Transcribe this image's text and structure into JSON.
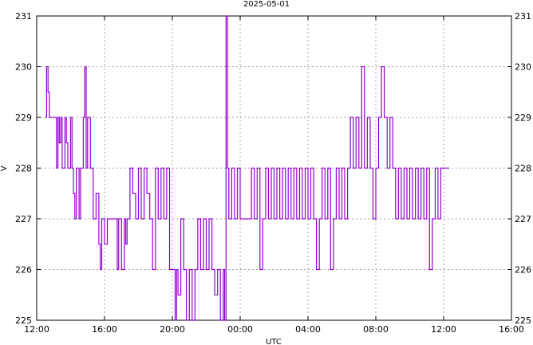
{
  "chart_data": {
    "type": "line",
    "title": "2025-05-01",
    "xlabel": "UTC",
    "ylabel": "V",
    "x_ticks": [
      "12:00",
      "16:00",
      "20:00",
      "00:00",
      "04:00",
      "08:00",
      "12:00",
      "16:00"
    ],
    "y_ticks": [
      "225",
      "226",
      "227",
      "228",
      "229",
      "230",
      "231"
    ],
    "y_ticks_right": [
      "225",
      "226",
      "227",
      "228",
      "229",
      "230",
      "231"
    ],
    "xlim": [
      "2025-05-01 12:00",
      "2025-05-02 16:00"
    ],
    "ylim": [
      225,
      231
    ],
    "grid": true,
    "line_color": "#9400d3",
    "series": [
      {
        "points": [
          [
            "12:30",
            229
          ],
          [
            "12:35",
            230
          ],
          [
            "12:40",
            229.5
          ],
          [
            "12:45",
            229
          ],
          [
            "13:00",
            229
          ],
          [
            "13:10",
            228
          ],
          [
            "13:15",
            229
          ],
          [
            "13:20",
            228.5
          ],
          [
            "13:25",
            229
          ],
          [
            "13:30",
            228
          ],
          [
            "13:40",
            229
          ],
          [
            "13:45",
            228.5
          ],
          [
            "13:50",
            228
          ],
          [
            "14:00",
            229
          ],
          [
            "14:05",
            228
          ],
          [
            "14:10",
            227.5
          ],
          [
            "14:15",
            227
          ],
          [
            "14:20",
            228
          ],
          [
            "14:30",
            227
          ],
          [
            "14:35",
            228
          ],
          [
            "14:45",
            229
          ],
          [
            "14:50",
            230
          ],
          [
            "14:55",
            228
          ],
          [
            "15:00",
            229
          ],
          [
            "15:10",
            228
          ],
          [
            "15:20",
            227
          ],
          [
            "15:30",
            227.5
          ],
          [
            "15:40",
            226.5
          ],
          [
            "15:45",
            226
          ],
          [
            "15:50",
            227
          ],
          [
            "16:00",
            226.5
          ],
          [
            "16:10",
            227
          ],
          [
            "16:30",
            227
          ],
          [
            "16:45",
            226
          ],
          [
            "16:50",
            227
          ],
          [
            "17:00",
            226
          ],
          [
            "17:10",
            227
          ],
          [
            "17:15",
            226.5
          ],
          [
            "17:20",
            227
          ],
          [
            "17:30",
            228
          ],
          [
            "17:40",
            227.5
          ],
          [
            "17:50",
            227
          ],
          [
            "18:00",
            228
          ],
          [
            "18:10",
            227
          ],
          [
            "18:20",
            228
          ],
          [
            "18:30",
            227.5
          ],
          [
            "18:40",
            227
          ],
          [
            "18:50",
            226
          ],
          [
            "19:00",
            228
          ],
          [
            "19:10",
            227
          ],
          [
            "19:20",
            228
          ],
          [
            "19:30",
            227
          ],
          [
            "19:40",
            228
          ],
          [
            "19:50",
            226
          ],
          [
            "20:00",
            226
          ],
          [
            "20:10",
            225
          ],
          [
            "20:15",
            226
          ],
          [
            "20:20",
            225.5
          ],
          [
            "20:30",
            227
          ],
          [
            "20:40",
            226
          ],
          [
            "20:50",
            225
          ],
          [
            "21:00",
            226
          ],
          [
            "21:10",
            225
          ],
          [
            "21:20",
            226
          ],
          [
            "21:30",
            227
          ],
          [
            "21:40",
            226
          ],
          [
            "21:50",
            227
          ],
          [
            "22:00",
            226
          ],
          [
            "22:10",
            227
          ],
          [
            "22:20",
            226
          ],
          [
            "22:30",
            225.5
          ],
          [
            "22:40",
            226
          ],
          [
            "22:50",
            225
          ],
          [
            "23:00",
            226
          ],
          [
            "23:05",
            225
          ],
          [
            "23:10",
            231
          ],
          [
            "23:15",
            228
          ],
          [
            "23:20",
            227
          ],
          [
            "23:30",
            228
          ],
          [
            "23:40",
            227
          ],
          [
            "23:50",
            228
          ],
          [
            "00:00",
            227
          ],
          [
            "00:30",
            227
          ],
          [
            "00:40",
            228
          ],
          [
            "00:50",
            227
          ],
          [
            "01:00",
            228
          ],
          [
            "01:10",
            226
          ],
          [
            "01:20",
            227
          ],
          [
            "01:30",
            228
          ],
          [
            "01:40",
            227
          ],
          [
            "01:50",
            228
          ],
          [
            "02:00",
            227
          ],
          [
            "02:10",
            228
          ],
          [
            "02:20",
            227
          ],
          [
            "02:30",
            228
          ],
          [
            "02:40",
            227
          ],
          [
            "02:50",
            228
          ],
          [
            "03:00",
            227
          ],
          [
            "03:10",
            228
          ],
          [
            "03:20",
            227
          ],
          [
            "03:30",
            228
          ],
          [
            "03:40",
            227
          ],
          [
            "03:50",
            228
          ],
          [
            "04:00",
            227
          ],
          [
            "04:10",
            228
          ],
          [
            "04:20",
            227
          ],
          [
            "04:30",
            226
          ],
          [
            "04:40",
            227
          ],
          [
            "04:50",
            228
          ],
          [
            "05:00",
            227
          ],
          [
            "05:10",
            228
          ],
          [
            "05:20",
            226
          ],
          [
            "05:30",
            227
          ],
          [
            "05:40",
            228
          ],
          [
            "05:50",
            227
          ],
          [
            "06:00",
            228
          ],
          [
            "06:10",
            227
          ],
          [
            "06:20",
            228
          ],
          [
            "06:30",
            229
          ],
          [
            "06:40",
            228
          ],
          [
            "06:50",
            229
          ],
          [
            "07:00",
            228
          ],
          [
            "07:10",
            230
          ],
          [
            "07:20",
            228
          ],
          [
            "07:30",
            229
          ],
          [
            "07:40",
            228
          ],
          [
            "07:50",
            227
          ],
          [
            "08:00",
            228
          ],
          [
            "08:10",
            229
          ],
          [
            "08:20",
            230
          ],
          [
            "08:30",
            229
          ],
          [
            "08:40",
            228
          ],
          [
            "08:50",
            229
          ],
          [
            "09:00",
            228
          ],
          [
            "09:10",
            227
          ],
          [
            "09:20",
            228
          ],
          [
            "09:30",
            227
          ],
          [
            "09:40",
            228
          ],
          [
            "09:50",
            227
          ],
          [
            "10:00",
            228
          ],
          [
            "10:10",
            227
          ],
          [
            "10:20",
            228
          ],
          [
            "10:30",
            227
          ],
          [
            "10:40",
            228
          ],
          [
            "10:50",
            227
          ],
          [
            "11:00",
            228
          ],
          [
            "11:10",
            226
          ],
          [
            "11:20",
            227
          ],
          [
            "11:30",
            228
          ],
          [
            "11:40",
            227
          ],
          [
            "11:50",
            228
          ],
          [
            "12:00",
            228
          ],
          [
            "12:20",
            228
          ]
        ]
      }
    ]
  }
}
